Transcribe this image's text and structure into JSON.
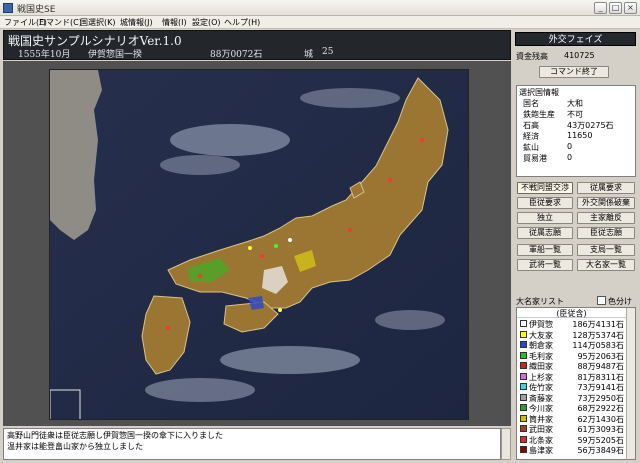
{
  "window": {
    "title": "戦国史SE",
    "controls": {
      "minimize": "_",
      "maximize": "□",
      "close": "×"
    }
  },
  "menu": [
    "ファイル(F)",
    "コマンド(C)",
    "国選択(K)",
    "城情報(J)",
    "情報(I)",
    "設定(O)",
    "ヘルプ(H)"
  ],
  "header": {
    "scenario_title": "戦国史サンプルシナリオVer.1.0",
    "date": "1555年10月",
    "clan": "伊賀惣国一揆",
    "koku": "88万0072石",
    "castle_label": "城",
    "castle_count": "25"
  },
  "panel": {
    "phase": "外交フェイズ",
    "funds_label": "資金残高",
    "funds_value": "410725",
    "end_command": "コマンド終了",
    "selected_country": {
      "title": "選択国情報",
      "rows": [
        {
          "label": "国名",
          "value": "大和"
        },
        {
          "label": "鉄鉋生産",
          "value": "不可"
        },
        {
          "label": "石高",
          "value": "43万0275石"
        },
        {
          "label": "経済",
          "value": "11650"
        },
        {
          "label": "鉱山",
          "value": "0"
        },
        {
          "label": "貿易港",
          "value": "0"
        }
      ]
    },
    "actions": [
      "不戦同盟交渉",
      "従属要求",
      "臣従要求",
      "外交関係破棄",
      "独立",
      "主家離反",
      "従属志願",
      "臣従志願"
    ],
    "lists": [
      "軍船一覧",
      "支局一覧",
      "武将一覧",
      "大名家一覧"
    ],
    "daimyo_list_title": "大名家リスト",
    "color_display_label": "色分け表示",
    "daimyo_header": "(臣従含)",
    "daimyo": [
      {
        "name": "伊賀惣",
        "koku": "186万4131石",
        "color": "#ffffff"
      },
      {
        "name": "大友家",
        "koku": "128万5374石",
        "color": "#ffff00"
      },
      {
        "name": "朝倉家",
        "koku": "114万0583石",
        "color": "#2a47c8"
      },
      {
        "name": "毛利家",
        "koku": "95万2063石",
        "color": "#22c022"
      },
      {
        "name": "織田家",
        "koku": "88万9487石",
        "color": "#d02020"
      },
      {
        "name": "上杉家",
        "koku": "81万8311石",
        "color": "#d070e0"
      },
      {
        "name": "佐竹家",
        "koku": "73万9141石",
        "color": "#40d0e0"
      },
      {
        "name": "斎藤家",
        "koku": "73万2950石",
        "color": "#a0a0a0"
      },
      {
        "name": "今川家",
        "koku": "68万2922石",
        "color": "#3a9a3a"
      },
      {
        "name": "筒井家",
        "koku": "62万1430石",
        "color": "#c8c000"
      },
      {
        "name": "武田家",
        "koku": "61万3093石",
        "color": "#a04020"
      },
      {
        "name": "北条家",
        "koku": "59万5205石",
        "color": "#d83030"
      },
      {
        "name": "島津家",
        "koku": "56万3849石",
        "color": "#8b0000"
      }
    ]
  },
  "log": [
    "高野山門徒衆は臣従志願し伊賀惣国一揆の傘下に入りました",
    "温井家は能登畠山家から独立しました"
  ]
}
